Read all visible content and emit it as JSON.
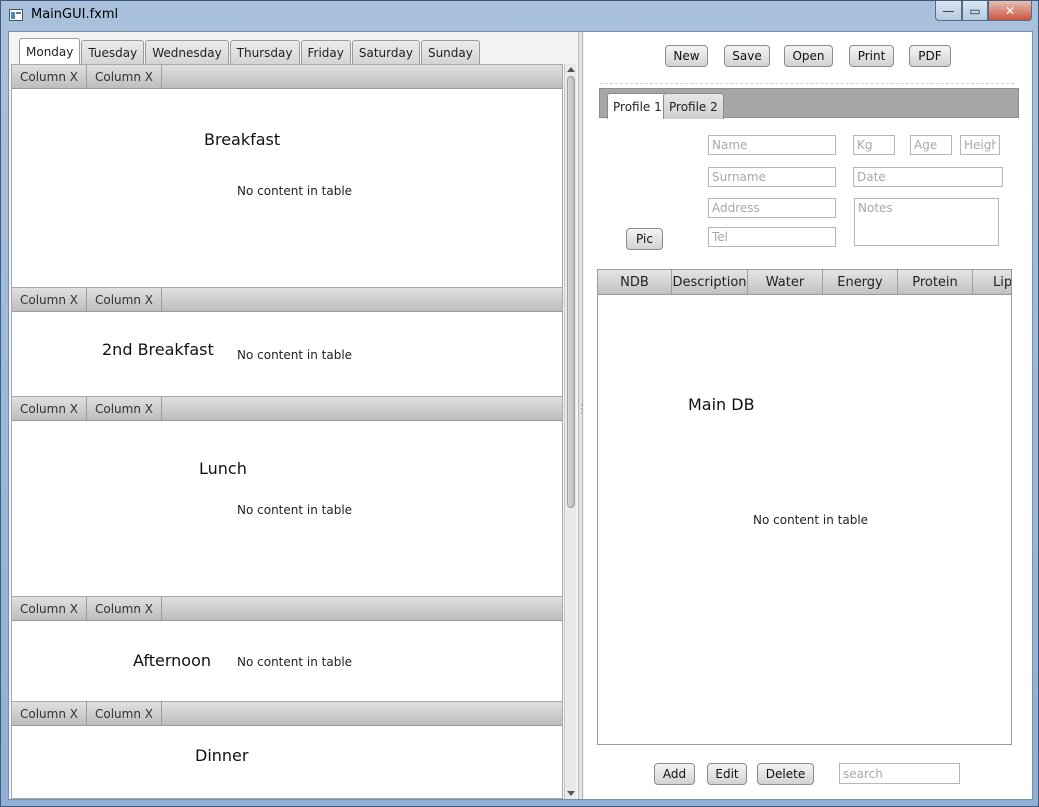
{
  "window": {
    "title": "MainGUI.fxml",
    "controls": {
      "minimize": "—",
      "maximize": "▭",
      "close": "✕"
    }
  },
  "days": {
    "tabs": [
      "Monday",
      "Tuesday",
      "Wednesday",
      "Thursday",
      "Friday",
      "Saturday",
      "Sunday"
    ],
    "active": "Monday"
  },
  "meals": [
    {
      "label": "Breakfast",
      "columns": [
        "Column X",
        "Column X"
      ],
      "empty_text": "No content in table"
    },
    {
      "label": "2nd Breakfast",
      "columns": [
        "Column X",
        "Column X"
      ],
      "empty_text": "No content in table"
    },
    {
      "label": "Lunch",
      "columns": [
        "Column X",
        "Column X"
      ],
      "empty_text": "No content in table"
    },
    {
      "label": "Afternoon",
      "columns": [
        "Column X",
        "Column X"
      ],
      "empty_text": "No content in table"
    },
    {
      "label": "Dinner",
      "columns": [
        "Column X",
        "Column X"
      ],
      "empty_text": ""
    }
  ],
  "toolbar": {
    "new_label": "New",
    "save_label": "Save",
    "open_label": "Open",
    "print_label": "Print",
    "pdf_label": "PDF"
  },
  "profile": {
    "tabs": [
      "Profile 1",
      "Profile 2"
    ],
    "pic_label": "Pic",
    "placeholders": {
      "name": "Name",
      "surname": "Surname",
      "address": "Address",
      "tel": "Tel",
      "kg": "Kg",
      "age": "Age",
      "height": "Heigh",
      "date": "Date",
      "notes": "Notes"
    }
  },
  "main_db": {
    "label": "Main DB",
    "columns": [
      "NDB",
      "Description",
      "Water",
      "Energy",
      "Protein",
      "Lip"
    ],
    "empty_text": "No content in table"
  },
  "bottom": {
    "add_label": "Add",
    "edit_label": "Edit",
    "delete_label": "Delete",
    "search_placeholder": "search"
  }
}
